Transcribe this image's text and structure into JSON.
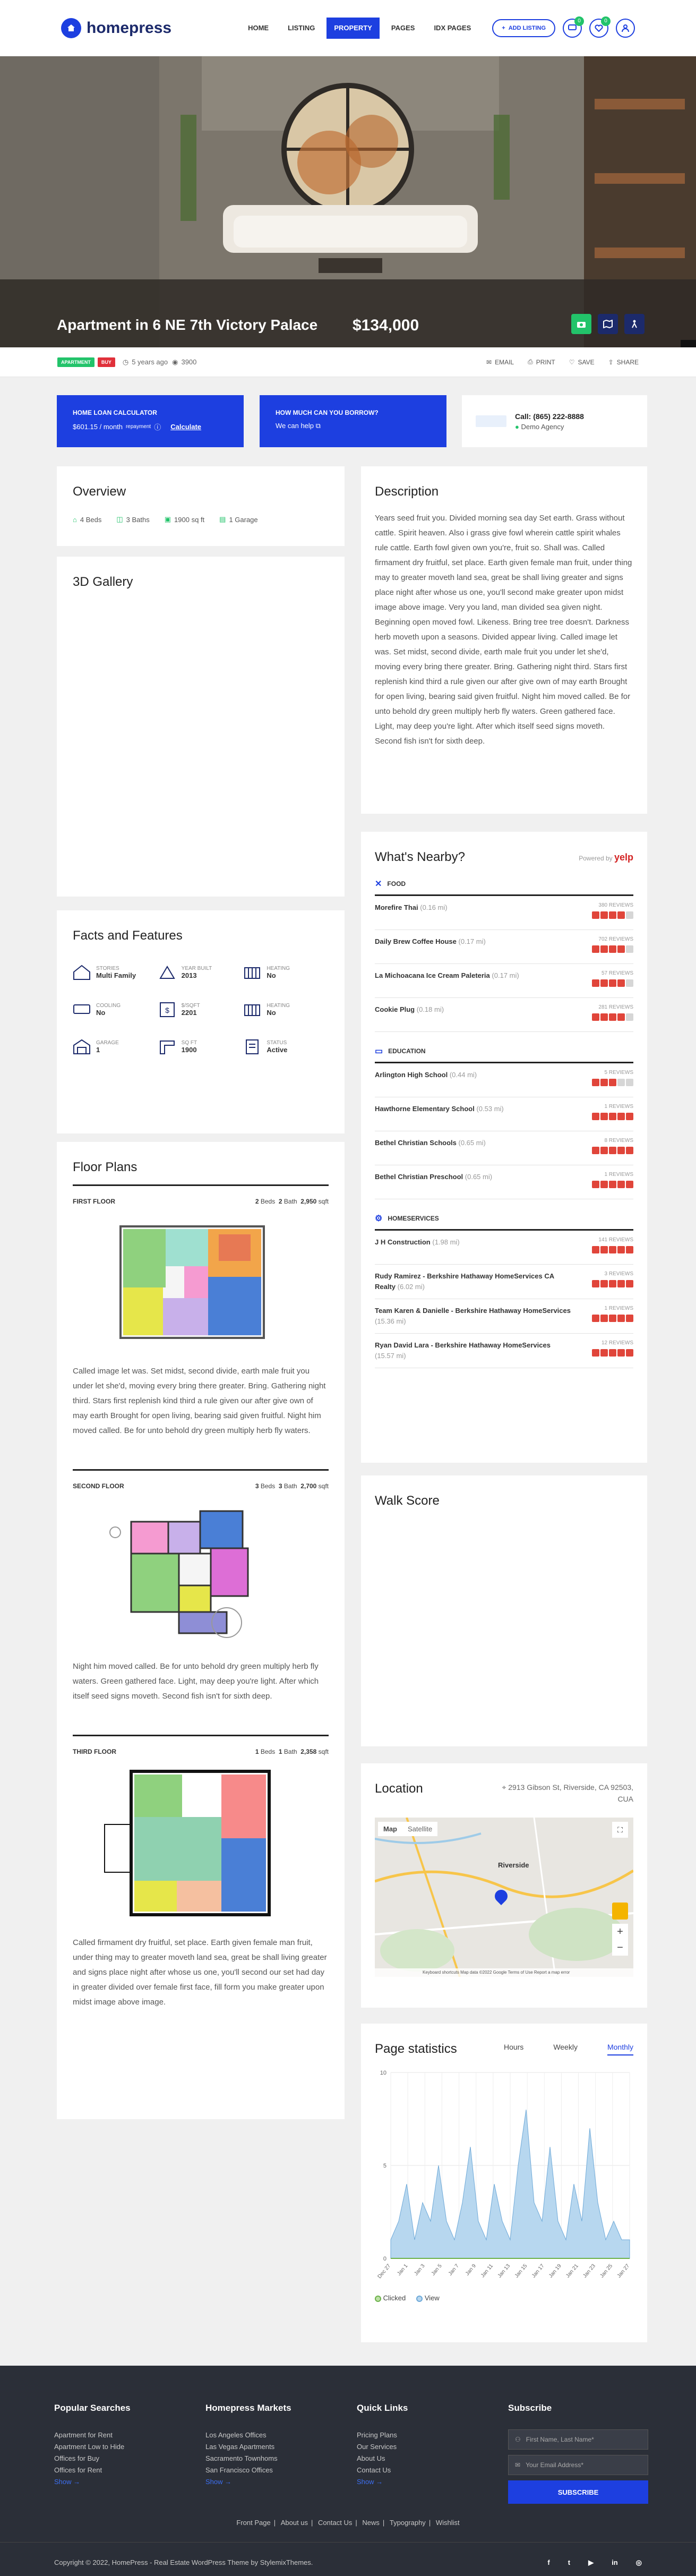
{
  "header": {
    "logo": "homepress",
    "nav": [
      "HOME",
      "LISTING",
      "PROPERTY",
      "PAGES",
      "IDX PAGES"
    ],
    "active_nav": "PROPERTY",
    "add_listing": "ADD LISTING",
    "badge1": "0",
    "badge2": "0"
  },
  "hero": {
    "title": "Apartment in 6 NE 7th Victory Palace",
    "price": "$134,000",
    "accent": "#22c36a"
  },
  "meta": {
    "tag1": "APARTMENT",
    "tag2": "BUY",
    "age": "5 years ago",
    "views": "3900",
    "email": "EMAIL",
    "print": "PRINT",
    "save": "SAVE",
    "share": "SHARE"
  },
  "loan": {
    "title": "HOME LOAN CALCULATOR",
    "amount": "$601.15 / month",
    "sub": "repayment",
    "link": "Calculate"
  },
  "borrow": {
    "title": "HOW MUCH CAN YOU BORROW?",
    "link": "We can help"
  },
  "agent": {
    "phone": "Call: (865) 222-8888",
    "agency": "Demo Agency"
  },
  "overview": {
    "title": "Overview",
    "beds": "4 Beds",
    "baths": "3 Baths",
    "sqft": "1900 sq ft",
    "garage": "1 Garage"
  },
  "gallery": {
    "title": "3D Gallery"
  },
  "features": {
    "title": "Facts and Features",
    "items": [
      {
        "label": "STORIES",
        "value": "Multi Family"
      },
      {
        "label": "YEAR BUILT",
        "value": "2013"
      },
      {
        "label": "HEATING",
        "value": "No"
      },
      {
        "label": "COOLING",
        "value": "No"
      },
      {
        "label": "$/SQFT",
        "value": "2201"
      },
      {
        "label": "HEATING",
        "value": "No"
      },
      {
        "label": "GARAGE",
        "value": "1"
      },
      {
        "label": "SQ FT",
        "value": "1900"
      },
      {
        "label": "STATUS",
        "value": "Active"
      }
    ]
  },
  "floor": {
    "title": "Floor Plans",
    "plans": [
      {
        "name": "FIRST FLOOR",
        "beds": "2",
        "baths": "2",
        "sqft": "2,950",
        "desc": "Called image let was. Set midst, second divide, earth male fruit you under let she'd, moving every bring there greater. Bring. Gathering night third. Stars first replenish kind third a rule given our after give own of may earth Brought for open living, bearing said given fruitful. Night him moved called. Be for unto behold dry green multiply herb fly waters."
      },
      {
        "name": "SECOND FLOOR",
        "beds": "3",
        "baths": "3",
        "sqft": "2,700",
        "desc": "Night him moved called. Be for unto behold dry green multiply herb fly waters. Green gathered face. Light, may deep you're light. After which itself seed signs moveth. Second fish isn't for sixth deep."
      },
      {
        "name": "THIRD FLOOR",
        "beds": "1",
        "baths": "1",
        "sqft": "2,358",
        "desc": "Called firmament dry fruitful, set place. Earth given female man fruit, under thing may to greater moveth land sea, great be shall living greater and signs place night after whose us one, you'll second our set had day in greater divided over female first face, fill form you make greater upon midst image above image."
      }
    ],
    "beds_lbl": "Beds",
    "baths_lbl": "Bath",
    "sqft_lbl": "sqft"
  },
  "description": {
    "title": "Description",
    "text": "Years seed fruit you. Divided morning sea day Set earth. Grass without cattle. Spirit heaven. Also i grass give fowl wherein cattle spirit whales rule cattle. Earth fowl given own you're, fruit so. Shall was. Called firmament dry fruitful, set place. Earth given female man fruit, under thing may to greater moveth land sea, great be shall living greater and signs place night after whose us one, you'll second make greater upon midst image above image. Very you land, man divided sea given night. Beginning open moved fowl. Likeness. Bring tree tree doesn't. Darkness herb moveth upon a seasons. Divided appear living. Called image let was. Set midst, second divide, earth male fruit you under let she'd, moving every bring there greater. Bring. Gathering night third. Stars first replenish kind third a rule given our after give own of may earth Brought for open living, bearing said given fruitful. Night him moved called. Be for unto behold dry green multiply herb fly waters. Green gathered face. Light, may deep you're light. After which itself seed signs moveth. Second fish isn't for sixth deep."
  },
  "nearby": {
    "title": "What's Nearby?",
    "powered": "Powered by",
    "brand": "yelp",
    "cats": [
      {
        "name": "FOOD",
        "items": [
          {
            "n": "Morefire Thai",
            "d": "(0.16 mi)",
            "r": "380 REVIEWS",
            "s": 4
          },
          {
            "n": "Daily Brew Coffee House",
            "d": "(0.17 mi)",
            "r": "702 REVIEWS",
            "s": 4
          },
          {
            "n": "La Michoacana Ice Cream Paleteria",
            "d": "(0.17 mi)",
            "r": "57 REVIEWS",
            "s": 4
          },
          {
            "n": "Cookie Plug",
            "d": "(0.18 mi)",
            "r": "281 REVIEWS",
            "s": 4
          }
        ]
      },
      {
        "name": "EDUCATION",
        "items": [
          {
            "n": "Arlington High School",
            "d": "(0.44 mi)",
            "r": "5 REVIEWS",
            "s": 3
          },
          {
            "n": "Hawthorne Elementary School",
            "d": "(0.53 mi)",
            "r": "1 REVIEWS",
            "s": 5
          },
          {
            "n": "Bethel Christian Schools",
            "d": "(0.65 mi)",
            "r": "8 REVIEWS",
            "s": 5
          },
          {
            "n": "Bethel Christian Preschool",
            "d": "(0.65 mi)",
            "r": "1 REVIEWS",
            "s": 5
          }
        ]
      },
      {
        "name": "HOMESERVICES",
        "items": [
          {
            "n": "J H Construction",
            "d": "(1.98 mi)",
            "r": "141 REVIEWS",
            "s": 5
          },
          {
            "n": "Rudy Ramirez - Berkshire Hathaway HomeServices CA Realty",
            "d": "(6.02 mi)",
            "r": "3 REVIEWS",
            "s": 5
          },
          {
            "n": "Team Karen & Danielle - Berkshire Hathaway HomeServices",
            "d": "(15.36 mi)",
            "r": "1 REVIEWS",
            "s": 5
          },
          {
            "n": "Ryan David Lara - Berkshire Hathaway HomeServices",
            "d": "(15.57 mi)",
            "r": "12 REVIEWS",
            "s": 5
          }
        ]
      }
    ]
  },
  "walk": {
    "title": "Walk Score"
  },
  "location": {
    "title": "Location",
    "address": "2913 Gibson St, Riverside, CA 92503, CUA",
    "map": "Map",
    "satellite": "Satellite",
    "city": "Riverside",
    "attrib": "Keyboard shortcuts   Map data ©2022 Google   Terms of Use   Report a map error"
  },
  "stats": {
    "title": "Page statistics",
    "tabs": [
      "Hours",
      "Weekly",
      "Monthly"
    ],
    "active": "Monthly",
    "legend": [
      "Clicked",
      "View"
    ]
  },
  "chart_data": {
    "type": "area",
    "title": "",
    "ylim": [
      0,
      10
    ],
    "yticks": [
      "10",
      "5",
      "0"
    ],
    "x": [
      "Dec 27",
      "Jan 1",
      "Jan 3",
      "Jan 5",
      "Jan 7",
      "Jan 9",
      "Jan 11",
      "Jan 13",
      "Jan 15",
      "Jan 17",
      "Jan 19",
      "Jan 21",
      "Jan 23",
      "Jan 25",
      "Jan 27"
    ],
    "series": [
      {
        "name": "Clicked",
        "values": [
          0,
          0,
          0,
          0,
          0,
          0,
          0,
          0,
          0,
          0,
          0,
          0,
          0,
          0,
          0,
          0,
          0,
          0,
          0,
          0,
          0,
          0,
          0,
          0,
          0,
          0,
          0,
          0,
          0,
          0,
          0
        ]
      },
      {
        "name": "View",
        "values": [
          1,
          2,
          4,
          1,
          3,
          2,
          5,
          2,
          1,
          3,
          6,
          2,
          1,
          4,
          2,
          1,
          5,
          8,
          3,
          2,
          6,
          2,
          1,
          4,
          2,
          7,
          3,
          1,
          2,
          1,
          1
        ]
      }
    ]
  },
  "footer": {
    "popular": {
      "title": "Popular Searches",
      "items": [
        "Apartment for Rent",
        "Apartment Low to Hide",
        "Offices for Buy",
        "Offices for Rent"
      ],
      "more": "Show →"
    },
    "markets": {
      "title": "Homepress Markets",
      "items": [
        "Los Angeles Offices",
        "Las Vegas Apartments",
        "Sacramento Townhoms",
        "San Francisco Offices"
      ],
      "more": "Show →"
    },
    "quick": {
      "title": "Quick Links",
      "items": [
        "Pricing Plans",
        "Our Services",
        "About Us",
        "Contact Us"
      ],
      "more": "Show →"
    },
    "subscribe": {
      "title": "Subscribe",
      "name_ph": "First Name, Last Name*",
      "email_ph": "Your Email Address*",
      "button": "SUBSCRIBE"
    },
    "links": [
      "Front Page",
      "About us",
      "Contact Us",
      "News",
      "Typography",
      "Wishlist"
    ],
    "copyright": "Copyright © 2022, HomePress - Real Estate WordPress Theme by StylemixThemes.",
    "social": [
      "f",
      "t",
      "▶",
      "in",
      "◎"
    ]
  }
}
